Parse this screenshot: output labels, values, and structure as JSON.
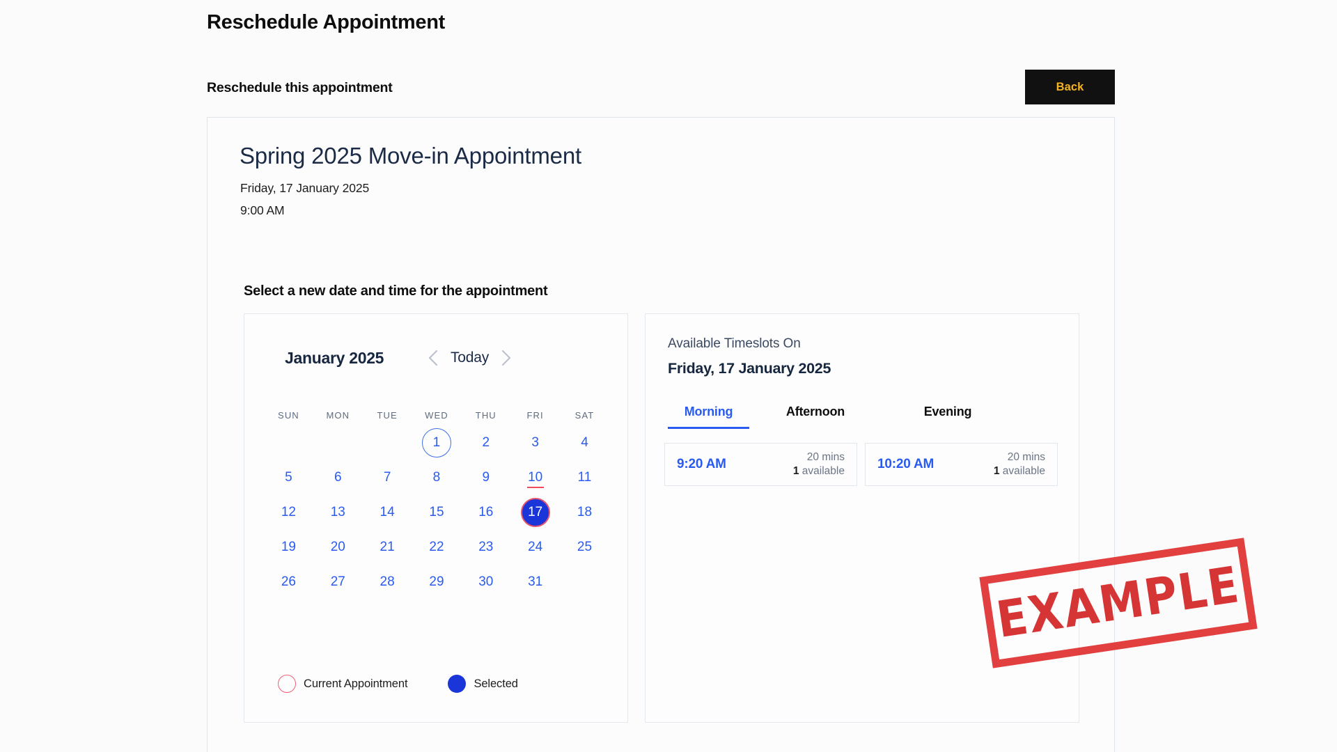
{
  "page": {
    "title": "Reschedule Appointment",
    "section_title": "Reschedule this appointment"
  },
  "toolbar": {
    "back_label": "Back",
    "back_bg": "#111111",
    "back_fg": "#f5b322"
  },
  "appointment": {
    "name": "Spring 2025 Move-in Appointment",
    "date": "Friday, 17 January 2025",
    "time": "9:00 AM"
  },
  "selector": {
    "label": "Select a new date and time for the appointment"
  },
  "calendar": {
    "month_label": "January 2025",
    "today_label": "Today",
    "prev_icon": "chevron-left-icon",
    "next_icon": "chevron-right-icon",
    "weekdays": [
      "SUN",
      "MON",
      "TUE",
      "WED",
      "THU",
      "FRI",
      "SAT"
    ],
    "leading_blanks": 3,
    "days": [
      {
        "n": "1",
        "state": "ring-blue"
      },
      {
        "n": "2",
        "state": ""
      },
      {
        "n": "3",
        "state": ""
      },
      {
        "n": "4",
        "state": ""
      },
      {
        "n": "5",
        "state": ""
      },
      {
        "n": "6",
        "state": ""
      },
      {
        "n": "7",
        "state": ""
      },
      {
        "n": "8",
        "state": ""
      },
      {
        "n": "9",
        "state": ""
      },
      {
        "n": "10",
        "state": "underline-red"
      },
      {
        "n": "11",
        "state": ""
      },
      {
        "n": "12",
        "state": ""
      },
      {
        "n": "13",
        "state": ""
      },
      {
        "n": "14",
        "state": ""
      },
      {
        "n": "15",
        "state": ""
      },
      {
        "n": "16",
        "state": ""
      },
      {
        "n": "17",
        "state": "selected"
      },
      {
        "n": "18",
        "state": ""
      },
      {
        "n": "19",
        "state": ""
      },
      {
        "n": "20",
        "state": ""
      },
      {
        "n": "21",
        "state": ""
      },
      {
        "n": "22",
        "state": ""
      },
      {
        "n": "23",
        "state": ""
      },
      {
        "n": "24",
        "state": ""
      },
      {
        "n": "25",
        "state": ""
      },
      {
        "n": "26",
        "state": ""
      },
      {
        "n": "27",
        "state": ""
      },
      {
        "n": "28",
        "state": ""
      },
      {
        "n": "29",
        "state": ""
      },
      {
        "n": "30",
        "state": ""
      },
      {
        "n": "31",
        "state": ""
      }
    ],
    "legend": [
      {
        "label": "Current Appointment",
        "style": "outline-pink",
        "color": "#ef6077"
      },
      {
        "label": "Selected",
        "style": "fill-blue",
        "color": "#1a35d8"
      }
    ]
  },
  "timeslots": {
    "subtitle": "Available Timeslots On",
    "date": "Friday, 17 January 2025",
    "tabs": [
      {
        "label": "Morning",
        "active": true
      },
      {
        "label": "Afternoon",
        "active": false
      },
      {
        "label": "Evening",
        "active": false
      }
    ],
    "slots": [
      {
        "time": "9:20 AM",
        "duration": "20 mins",
        "available_count": "1",
        "available_label": " available"
      },
      {
        "time": "10:20 AM",
        "duration": "20 mins",
        "available_count": "1",
        "available_label": " available"
      }
    ]
  },
  "watermark": {
    "text": "EXAMPLE",
    "color": "#d32525"
  }
}
